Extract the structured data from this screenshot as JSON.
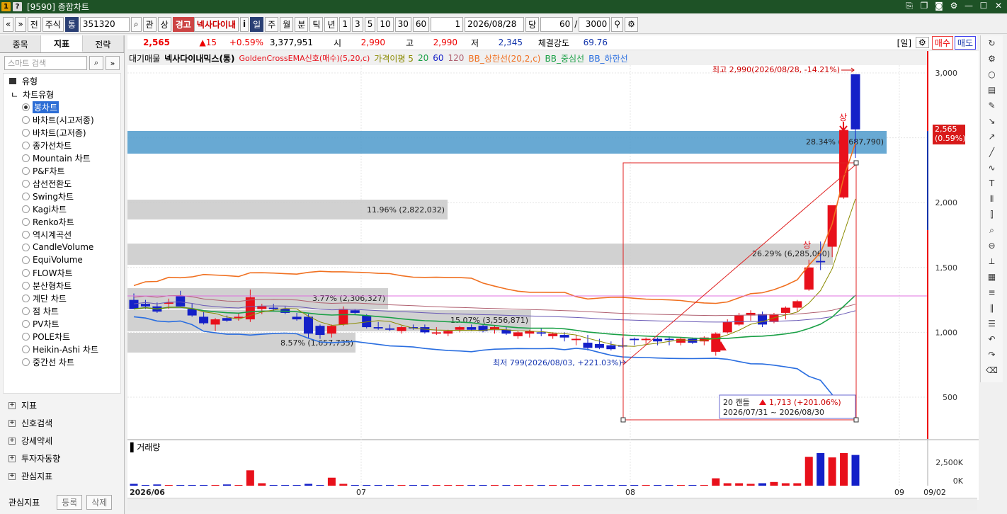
{
  "window": {
    "title": "[9590] 종합차트",
    "icon1": "1",
    "icon2": "?"
  },
  "toolbar": {
    "nav_prev": "«",
    "nav_down": "»",
    "btn_jeon": "전",
    "market": "주식",
    "tong": "통",
    "code": "351320",
    "btn_gwan": "관",
    "btn_sang": "상",
    "warn1": "경고",
    "stock_name": "넥사다이내",
    "info": "i",
    "periods": [
      "일",
      "주",
      "월",
      "분",
      "틱",
      "년"
    ],
    "intervals": [
      "1",
      "3",
      "5",
      "10",
      "30",
      "60"
    ],
    "count_val": "1",
    "date": "2026/08/28",
    "btn_dang": "당",
    "display_count": "60",
    "total": "3000"
  },
  "left_panel": {
    "tabs": [
      "종목",
      "지표",
      "전략"
    ],
    "search_placeholder": "스마트 검색",
    "header": "유형",
    "subheader": "차트유형",
    "chart_types": [
      "봉차트",
      "바차트(시고저종)",
      "바차트(고저종)",
      "종가선차트",
      "Mountain 차트",
      "P&F차트",
      "삼선전환도",
      "Swing차트",
      "Kagi차트",
      "Renko차트",
      "역시계곡선",
      "CandleVolume",
      "EquiVolume",
      "FLOW차트",
      "분산형차트",
      "계단 차트",
      "점 차트",
      "PV차트",
      "POLE차트",
      "Heikin-Ashi 차트",
      "중간선 차트"
    ],
    "groups": [
      "지표",
      "신호검색",
      "강세약세",
      "투자자동향",
      "관심지표"
    ],
    "bottom_label": "관심지표",
    "btn_register": "등록",
    "btn_delete": "삭제"
  },
  "info_bar": {
    "price": "2,565",
    "change": "▲15",
    "pct": "+0.59%",
    "volume": "3,377,951",
    "open_label": "시",
    "open": "2,990",
    "high_label": "고",
    "high": "2,990",
    "low_label": "저",
    "low": "2,345",
    "strength_label": "체결강도",
    "strength": "69.76",
    "period_tag": "[일]",
    "buy": "매수",
    "sell": "매도"
  },
  "legend": {
    "sup": "대기매물",
    "name": "넥사다이내믹스(통)",
    "signal": "GoldenCrossEMA신호(매수)(5,20,c)",
    "ma_label": "가격이평 5",
    "ma20": "20",
    "ma60": "60",
    "ma120": "120",
    "bb_up": "BB_상한선(20,2,c)",
    "bb_mid": "BB_중심선",
    "bb_low": "BB_하한선",
    "volume": "거래량"
  },
  "colors": {
    "up": "#e8101b",
    "down": "#1420c8",
    "ma5": "#8a8a00",
    "ma20": "#1aa046",
    "ma60": "#6a5ab6",
    "ma120": "#b06070",
    "bb_up": "#f07020",
    "bb_mid": "#1aa046",
    "bb_low": "#2a6ee0"
  },
  "chart_data": {
    "type": "candlestick",
    "y_ticks": [
      "3,000",
      "2,500",
      "2,000",
      "1,500",
      "1,000",
      "500"
    ],
    "vol_ticks": [
      "2,500K",
      "0K"
    ],
    "x_labels": [
      "2026/06",
      "07",
      "08",
      "09",
      "09/02"
    ],
    "ylim": [
      400,
      3000
    ],
    "candles": [
      [
        1250,
        1300,
        1200,
        1180
      ],
      [
        1220,
        1250,
        1180,
        1200
      ],
      [
        1200,
        1230,
        1150,
        1160
      ],
      [
        1220,
        1260,
        1180,
        1230
      ],
      [
        1280,
        1320,
        1200,
        1200
      ],
      [
        1180,
        1220,
        1120,
        1130
      ],
      [
        1120,
        1160,
        1060,
        1070
      ],
      [
        1060,
        1110,
        1010,
        1100
      ],
      [
        1110,
        1130,
        1080,
        1090
      ],
      [
        1110,
        1150,
        1090,
        1120
      ],
      [
        1100,
        1330,
        1080,
        1270
      ],
      [
        1180,
        1220,
        1140,
        1200
      ],
      [
        1190,
        1220,
        1160,
        1180
      ],
      [
        1180,
        1200,
        1140,
        1150
      ],
      [
        1120,
        1150,
        1090,
        1100
      ],
      [
        1120,
        1140,
        950,
        990
      ],
      [
        1050,
        1060,
        950,
        980
      ],
      [
        990,
        1060,
        960,
        1050
      ],
      [
        1060,
        1200,
        1050,
        1180
      ],
      [
        1170,
        1180,
        1140,
        1150
      ],
      [
        1130,
        1140,
        1030,
        1040
      ],
      [
        1040,
        1080,
        1020,
        1030
      ],
      [
        1030,
        1060,
        1010,
        1020
      ],
      [
        1010,
        1050,
        990,
        1040
      ],
      [
        1040,
        1060,
        1020,
        1030
      ],
      [
        1040,
        1060,
        990,
        1000
      ],
      [
        990,
        1040,
        980,
        1000
      ],
      [
        990,
        1020,
        970,
        1010
      ],
      [
        1020,
        1050,
        1000,
        1040
      ],
      [
        1040,
        1060,
        1010,
        1020
      ],
      [
        1050,
        1060,
        1000,
        1010
      ],
      [
        1020,
        1050,
        990,
        1040
      ],
      [
        1020,
        1040,
        980,
        990
      ],
      [
        970,
        1010,
        950,
        1000
      ],
      [
        990,
        1020,
        960,
        1010
      ],
      [
        1000,
        1030,
        970,
        990
      ],
      [
        970,
        1000,
        950,
        990
      ],
      [
        980,
        1000,
        930,
        960
      ],
      [
        940,
        980,
        900,
        950
      ],
      [
        920,
        980,
        860,
        880
      ],
      [
        910,
        950,
        870,
        880
      ],
      [
        900,
        930,
        860,
        870
      ],
      [
        900,
        960,
        880,
        890
      ],
      [
        950,
        960,
        900,
        940
      ],
      [
        940,
        960,
        910,
        950
      ],
      [
        950,
        960,
        900,
        930
      ],
      [
        950,
        970,
        900,
        940
      ],
      [
        920,
        960,
        900,
        950
      ],
      [
        950,
        960,
        910,
        920
      ],
      [
        930,
        970,
        900,
        960
      ],
      [
        850,
        1000,
        820,
        990
      ],
      [
        1000,
        1100,
        990,
        1080
      ],
      [
        1060,
        1150,
        1050,
        1130
      ],
      [
        1130,
        1170,
        1090,
        1150
      ],
      [
        1140,
        1160,
        1040,
        1060
      ],
      [
        1080,
        1150,
        1070,
        1140
      ],
      [
        1150,
        1200,
        1100,
        1190
      ],
      [
        1190,
        1250,
        1160,
        1240
      ],
      [
        1330,
        1560,
        1320,
        1500
      ],
      [
        1550,
        1700,
        1480,
        1540
      ],
      [
        1660,
        1800,
        1580,
        1980
      ],
      [
        2040,
        2610,
        2030,
        2560
      ],
      [
        2990,
        2990,
        2345,
        2565
      ]
    ],
    "annotations": {
      "high": "최고 2,990(2026/08/28, -14.21%)",
      "low": "최저 799(2026/08/03, +221.03%)",
      "band1": "28.34% (2,687,790)",
      "band2": "11.96% (2,822,032)",
      "band3": "26.29% (6,285,060)",
      "band4": "3.77% (2,306,327)",
      "band5": "15.07% (3,556,871)",
      "band6": "8.57% (1,657,735)",
      "sang": "상",
      "stat_title": "20 캔들",
      "stat_val": "1,713 (+201.06%)",
      "stat_range": "2026/07/31 ~ 2026/08/30",
      "price_tag": "2,565",
      "price_tag_pct": "(0.59%)"
    }
  }
}
